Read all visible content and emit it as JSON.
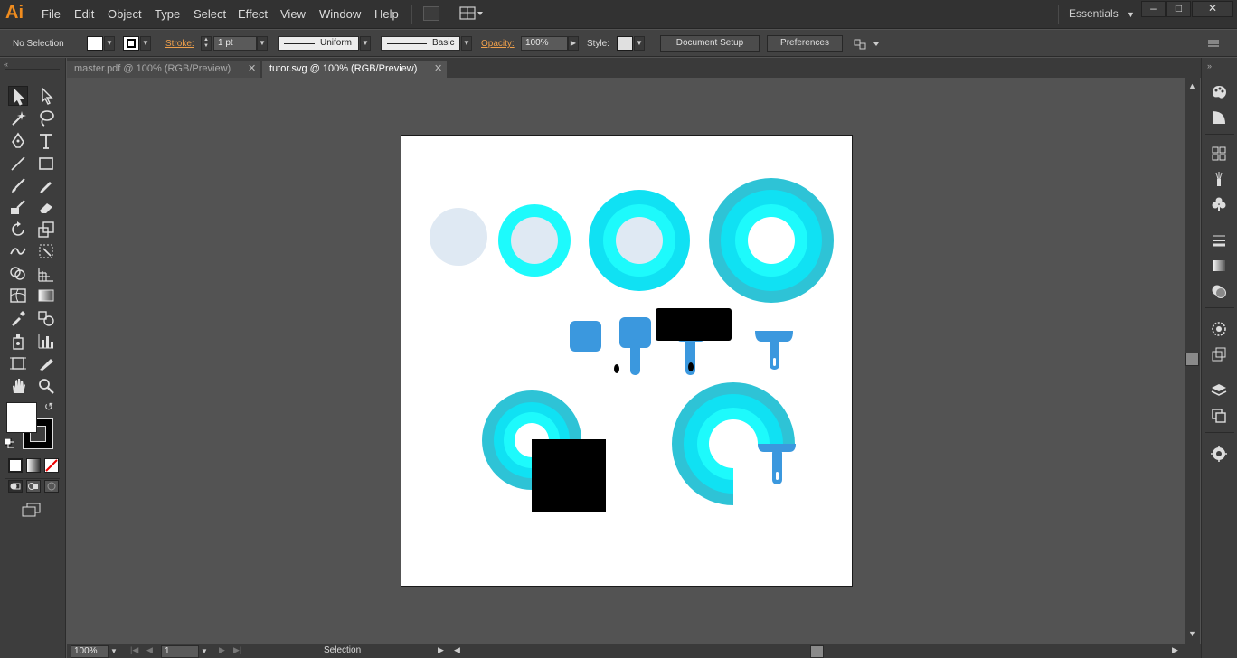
{
  "app": {
    "logo": "Ai"
  },
  "menu": {
    "items": [
      "File",
      "Edit",
      "Object",
      "Type",
      "Select",
      "Effect",
      "View",
      "Window",
      "Help"
    ],
    "workspace": "Essentials",
    "window_controls": [
      "–",
      "□",
      "✕"
    ]
  },
  "control_bar": {
    "selection_status": "No Selection",
    "stroke_label": "Stroke:",
    "stroke_weight": "1 pt",
    "stroke_profile": "Uniform",
    "brush": "Basic",
    "opacity_label": "Opacity:",
    "opacity_value": "100%",
    "style_label": "Style:",
    "document_setup": "Document Setup",
    "preferences": "Preferences"
  },
  "tabs": [
    {
      "label": "master.pdf @ 100% (RGB/Preview)",
      "active": false
    },
    {
      "label": "tutor.svg @ 100% (RGB/Preview)",
      "active": true
    }
  ],
  "status_bar": {
    "zoom": "100%",
    "artboard_number": "1",
    "current_tool": "Selection"
  },
  "colors": {
    "light_fill": "#dfe9f3",
    "cyan_bright": "#1dfafc",
    "cyan_mid": "#10e1f3",
    "cyan_outer": "#2ec3d6",
    "blue": "#3b98de",
    "black": "#000000"
  }
}
